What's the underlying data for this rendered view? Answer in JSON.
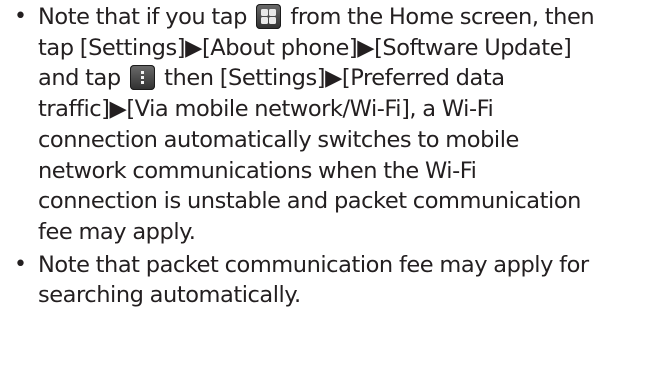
{
  "bullet_symbol": "•",
  "items": [
    {
      "lines": [
        {
          "before": "Note that if you tap ",
          "icon": "apps-icon",
          "after": " from the Home screen, then"
        },
        {
          "text": "tap [Settings]▶[About phone]▶[Software Update]"
        },
        {
          "before": "and tap ",
          "icon": "menu-icon",
          "after": " then [Settings]▶[Preferred data"
        },
        {
          "text": "traffic]▶[Via mobile network/Wi-Fi], a Wi-Fi"
        },
        {
          "text": "connection automatically switches to mobile"
        },
        {
          "text": "network communications when the Wi-Fi"
        },
        {
          "text": "connection is unstable and packet communication"
        },
        {
          "text": "fee may apply."
        }
      ]
    },
    {
      "lines": [
        {
          "text": "Note that packet communication fee may apply for"
        },
        {
          "text": "searching automatically."
        }
      ]
    }
  ]
}
